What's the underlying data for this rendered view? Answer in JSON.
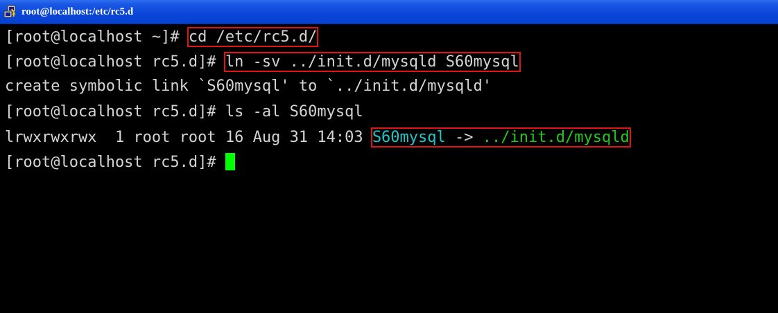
{
  "window": {
    "title": "root@localhost:/etc/rc5.d",
    "icon": "putty-terminal-icon"
  },
  "colors": {
    "background": "#000000",
    "text": "#d4d4d4",
    "link_name": "#1ec8c8",
    "link_target": "#22c81e",
    "cursor": "#00ff00",
    "highlight_box": "#e01414"
  },
  "terminal": {
    "line1": {
      "prompt": "[root@localhost ~]# ",
      "command": "cd /etc/rc5.d/"
    },
    "line2": {
      "prompt": "[root@localhost rc5.d]# ",
      "command": "ln -sv ../init.d/mysqld S60mysql"
    },
    "line3": {
      "output": "create symbolic link `S60mysql' to `../init.d/mysqld'"
    },
    "line4": {
      "prompt": "[root@localhost rc5.d]# ",
      "command": "ls -al S60mysql"
    },
    "line5": {
      "listing": "lrwxrwxrwx  1 root root 16 Aug 31 14:03 ",
      "link_name": "S60mysql",
      "arrow": " -> ",
      "link_target": "../init.d/mysqld"
    },
    "line6": {
      "prompt": "[root@localhost rc5.d]# "
    }
  }
}
